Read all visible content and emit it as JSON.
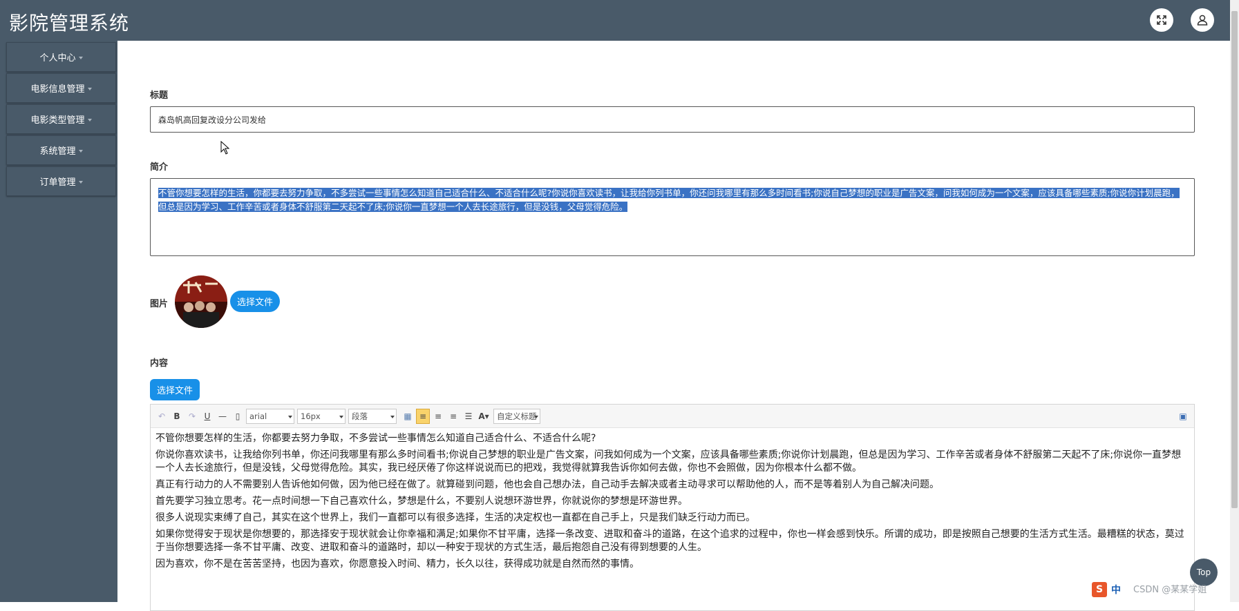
{
  "app": {
    "title": "影院管理系统"
  },
  "header": {
    "fullscreen_icon": "expand-icon",
    "user_icon": "user-icon"
  },
  "sidebar": {
    "items": [
      {
        "label": "个人中心"
      },
      {
        "label": "电影信息管理"
      },
      {
        "label": "电影类型管理"
      },
      {
        "label": "系统管理"
      },
      {
        "label": "订单管理"
      }
    ]
  },
  "form": {
    "title_label": "标题",
    "title_value": "森岛帆高回复改设分公司发给",
    "summary_label": "简介",
    "summary_value": "不管你想要怎样的生活，你都要去努力争取，不多尝试一些事情怎么知道自己适合什么、不适合什么呢?你说你喜欢读书，让我给你列书单，你还问我哪里有那么多时间看书;你说自己梦想的职业是广告文案，问我如何成为一个文案，应该具备哪些素质;你说你计划晨跑，但总是因为学习、工作辛苦或者身体不舒服第二天起不了床;你说你一直梦想一个人去长途旅行，但是没钱，父母觉得危险。",
    "image_label": "图片",
    "image_button": "选择文件",
    "content_label": "内容",
    "content_button": "选择文件"
  },
  "editor": {
    "font_family": "arial",
    "font_size": "16px",
    "paragraph": "段落",
    "custom_heading": "自定义标题",
    "paragraphs": [
      "不管你想要怎样的生活，你都要去努力争取，不多尝试一些事情怎么知道自己适合什么、不适合什么呢?",
      "你说你喜欢读书，让我给你列书单，你还问我哪里有那么多时间看书;你说自己梦想的职业是广告文案，问我如何成为一个文案，应该具备哪些素质;你说你计划晨跑，但总是因为学习、工作辛苦或者身体不舒服第二天起不了床;你说你一直梦想一个人去长途旅行，但是没钱，父母觉得危险。其实，我已经厌倦了你这样说说而已的把戏，我觉得就算我告诉你如何去做，你也不会照做，因为你根本什么都不做。",
      "真正有行动力的人不需要别人告诉他如何做，因为他已经在做了。就算碰到问题，他也会自己想办法，自己动手去解决或者主动寻求可以帮助他的人，而不是等着别人为自己解决问题。",
      "首先要学习独立思考。花一点时间想一下自己喜欢什么，梦想是什么，不要别人说想环游世界，你就说你的梦想是环游世界。",
      "很多人说现实束缚了自己，其实在这个世界上，我们一直都可以有很多选择，生活的决定权也一直都在自己手上，只是我们缺乏行动力而已。",
      "如果你觉得安于现状是你想要的，那选择安于现状就会让你幸福和满足;如果你不甘平庸，选择一条改变、进取和奋斗的道路，在这个追求的过程中，你也一样会感到快乐。所谓的成功，即是按照自己想要的生活方式生活。最糟糕的状态，莫过于当你想要选择一条不甘平庸、改变、进取和奋斗的道路时，却以一种安于现状的方式生活，最后抱怨自己没有得到想要的人生。",
      "因为喜欢，你不是在苦苦坚持，也因为喜欢，你愿意投入时间、精力，长久以往，获得成功就是自然而然的事情。"
    ]
  },
  "misc": {
    "top_button": "Top",
    "watermark": "CSDN @某某学姐",
    "ime_s": "S",
    "ime_zh": "中"
  },
  "colors": {
    "header_bg": "#495a69",
    "accent": "#1890e8",
    "selection": "#3a72c4"
  }
}
